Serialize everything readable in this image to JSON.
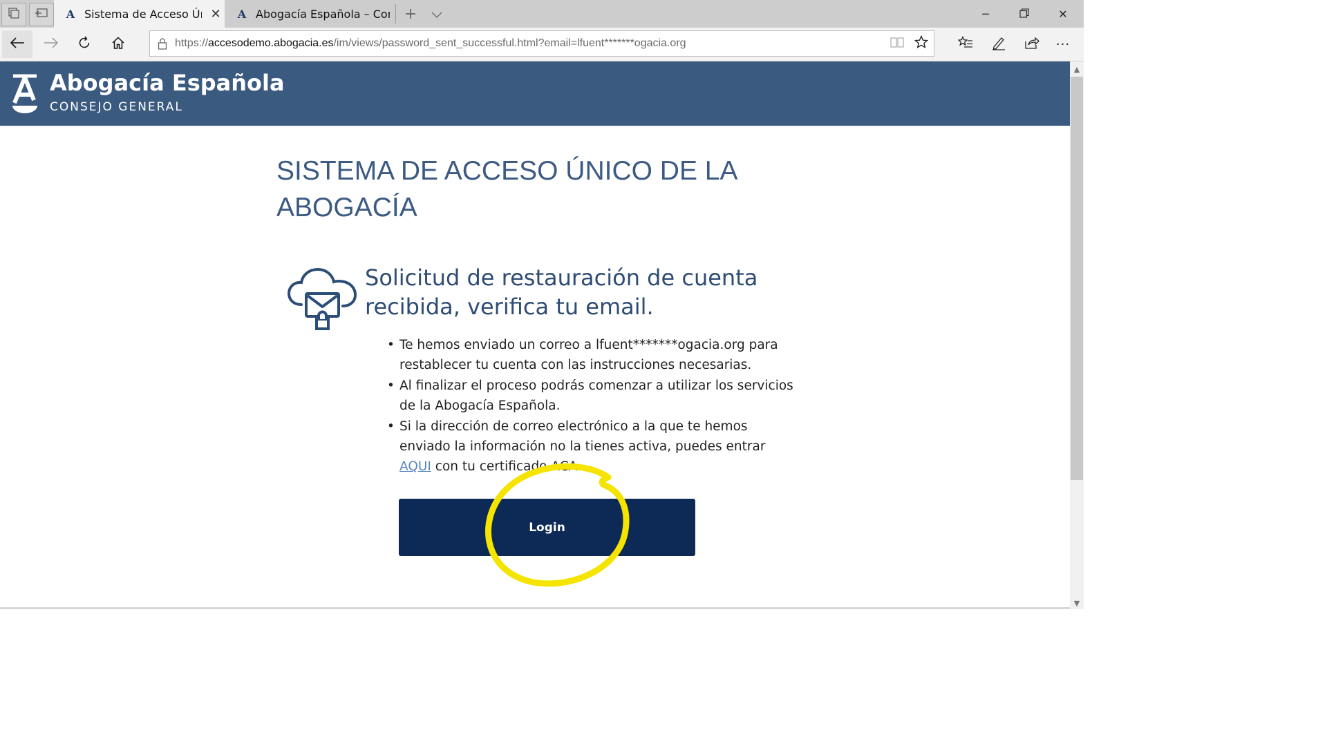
{
  "browser": {
    "tabs": [
      {
        "title": "Sistema de Acceso Únic",
        "favicon": "A",
        "active": true,
        "close": "✕"
      },
      {
        "title": "Abogacía Española – Conse",
        "favicon": "A",
        "active": false
      }
    ],
    "new_tab_symbol": "+",
    "tab_list_symbol": "⌄",
    "window_controls": {
      "minimize": "─",
      "restore": "❐",
      "close": "✕"
    },
    "address": {
      "scheme": "https://",
      "host": "accesodemo.abogacia.es",
      "path": "/im/views/password_sent_successful.html?email=lfuent*******ogacia.org"
    },
    "icons": [
      "tab-preview-icon",
      "set-aside-icon",
      "back-icon",
      "forward-icon",
      "refresh-icon",
      "home-icon",
      "lock-icon",
      "reading-view-icon",
      "favorite-star-icon",
      "favorites-list-icon",
      "pen-icon",
      "share-icon",
      "more-icon"
    ],
    "more_symbol": "···"
  },
  "site": {
    "brand_name": "Abogacía Española",
    "brand_sub": "CONSEJO GENERAL",
    "header_color": "#3a5a80"
  },
  "main": {
    "title": "SISTEMA DE ACCESO ÚNICO DE LA ABOGACÍA",
    "notice_title": "Solicitud de restauración de cuenta recibida, verifica tu email.",
    "items": [
      {
        "text": "Te hemos enviado un correo a lfuent*******ogacia.org para restablecer tu cuenta con las instrucciones necesarias."
      },
      {
        "text": "Al finalizar el proceso podrás comenzar a utilizar los servicios de la Abogacía Española."
      },
      {
        "before": "Si la dirección de correo electrónico a la que te hemos enviado la información no la tienes activa, puedes entrar ",
        "link": "AQUI",
        "after": " con tu certificado ACA."
      }
    ],
    "login_label": "Login",
    "button_color": "#0d2a57",
    "annotation_color": "#f5e400"
  }
}
